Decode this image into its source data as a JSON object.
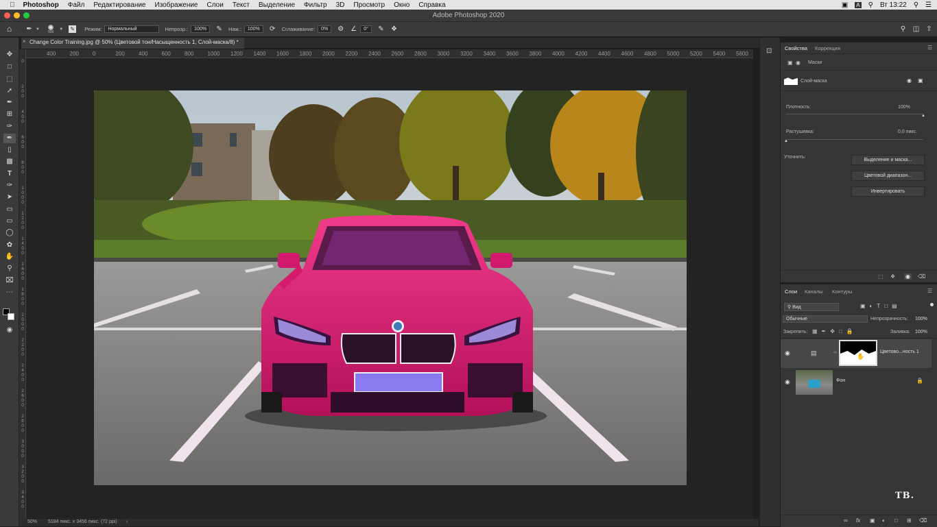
{
  "menubar": {
    "app": "Photoshop",
    "items": [
      "Файл",
      "Редактирование",
      "Изображение",
      "Слои",
      "Текст",
      "Выделение",
      "Фильтр",
      "3D",
      "Просмотр",
      "Окно",
      "Справка"
    ],
    "clock": "Вт 13:22",
    "input_lang": "A"
  },
  "window": {
    "title": "Adobe Photoshop 2020"
  },
  "options": {
    "brush_size": "500",
    "mode_label": "Режим:",
    "mode_value": "Нормальный",
    "opacity_label": "Непрозр.:",
    "opacity_value": "100%",
    "pressure_label": "Наж.:",
    "pressure_value": "100%",
    "smoothing_label": "Сглаживание:",
    "smoothing_value": "0%",
    "angle_value": "0°"
  },
  "document": {
    "tab_title": "Change Color Training.jpg @ 50% (Цветовой тон/Насыщенность 1, Слой-маска/8) *",
    "zoom": "50%",
    "info": "5184 пикс. x 3456 пикс. (72 ppi)"
  },
  "ruler": {
    "h_ticks": [
      "400",
      "200",
      "0",
      "200",
      "400",
      "600",
      "800",
      "1000",
      "1200",
      "1400",
      "1600",
      "1800",
      "2000",
      "2200",
      "2400",
      "2600",
      "2800",
      "3000",
      "3200",
      "3400",
      "3600",
      "3800",
      "4000",
      "4200",
      "4400",
      "4600",
      "4800",
      "5000",
      "5200",
      "5400",
      "5600"
    ],
    "v_ticks": [
      "0",
      "2 0 0",
      "4 0 0",
      "6 0 0",
      "8 0 0",
      "1 0 0 0",
      "1 2 0 0",
      "1 4 0 0",
      "1 6 0 0",
      "1 8 0 0",
      "2 0 0 0",
      "2 2 0 0",
      "2 4 0 0",
      "2 6 0 0",
      "2 8 0 0",
      "3 0 0 0",
      "3 2 0 0",
      "3 4 0 0"
    ]
  },
  "properties": {
    "tabs": [
      "Свойства",
      "Коррекция"
    ],
    "section": "Маски",
    "mask_label": "Слой-маска",
    "density_label": "Плотность:",
    "density_value": "100%",
    "density_level": 1.0,
    "feather_label": "Растушевка:",
    "feather_value": "0,0 пикс.",
    "feather_level": 0.0,
    "refine_label": "Уточнить:",
    "btn_select_mask": "Выделение и маска...",
    "btn_color_range": "Цветовой диапазон...",
    "btn_invert": "Инвертировать"
  },
  "layers": {
    "tabs": [
      "Слои",
      "Каналы",
      "Контуры"
    ],
    "filter_label": "Вид",
    "blend_mode": "Обычные",
    "opacity_label": "Непрозрачность:",
    "opacity_value": "100%",
    "lock_label": "Закрепить:",
    "fill_label": "Заливка:",
    "fill_value": "100%",
    "items": [
      {
        "name": "Цветово...ность 1"
      },
      {
        "name": "Фон"
      }
    ]
  },
  "watermark": "TB.",
  "colors": {
    "ui_dark": "#1e1e1e",
    "panel": "#353535",
    "car_magenta": "#e0206e",
    "selected_layer": "#474747"
  }
}
